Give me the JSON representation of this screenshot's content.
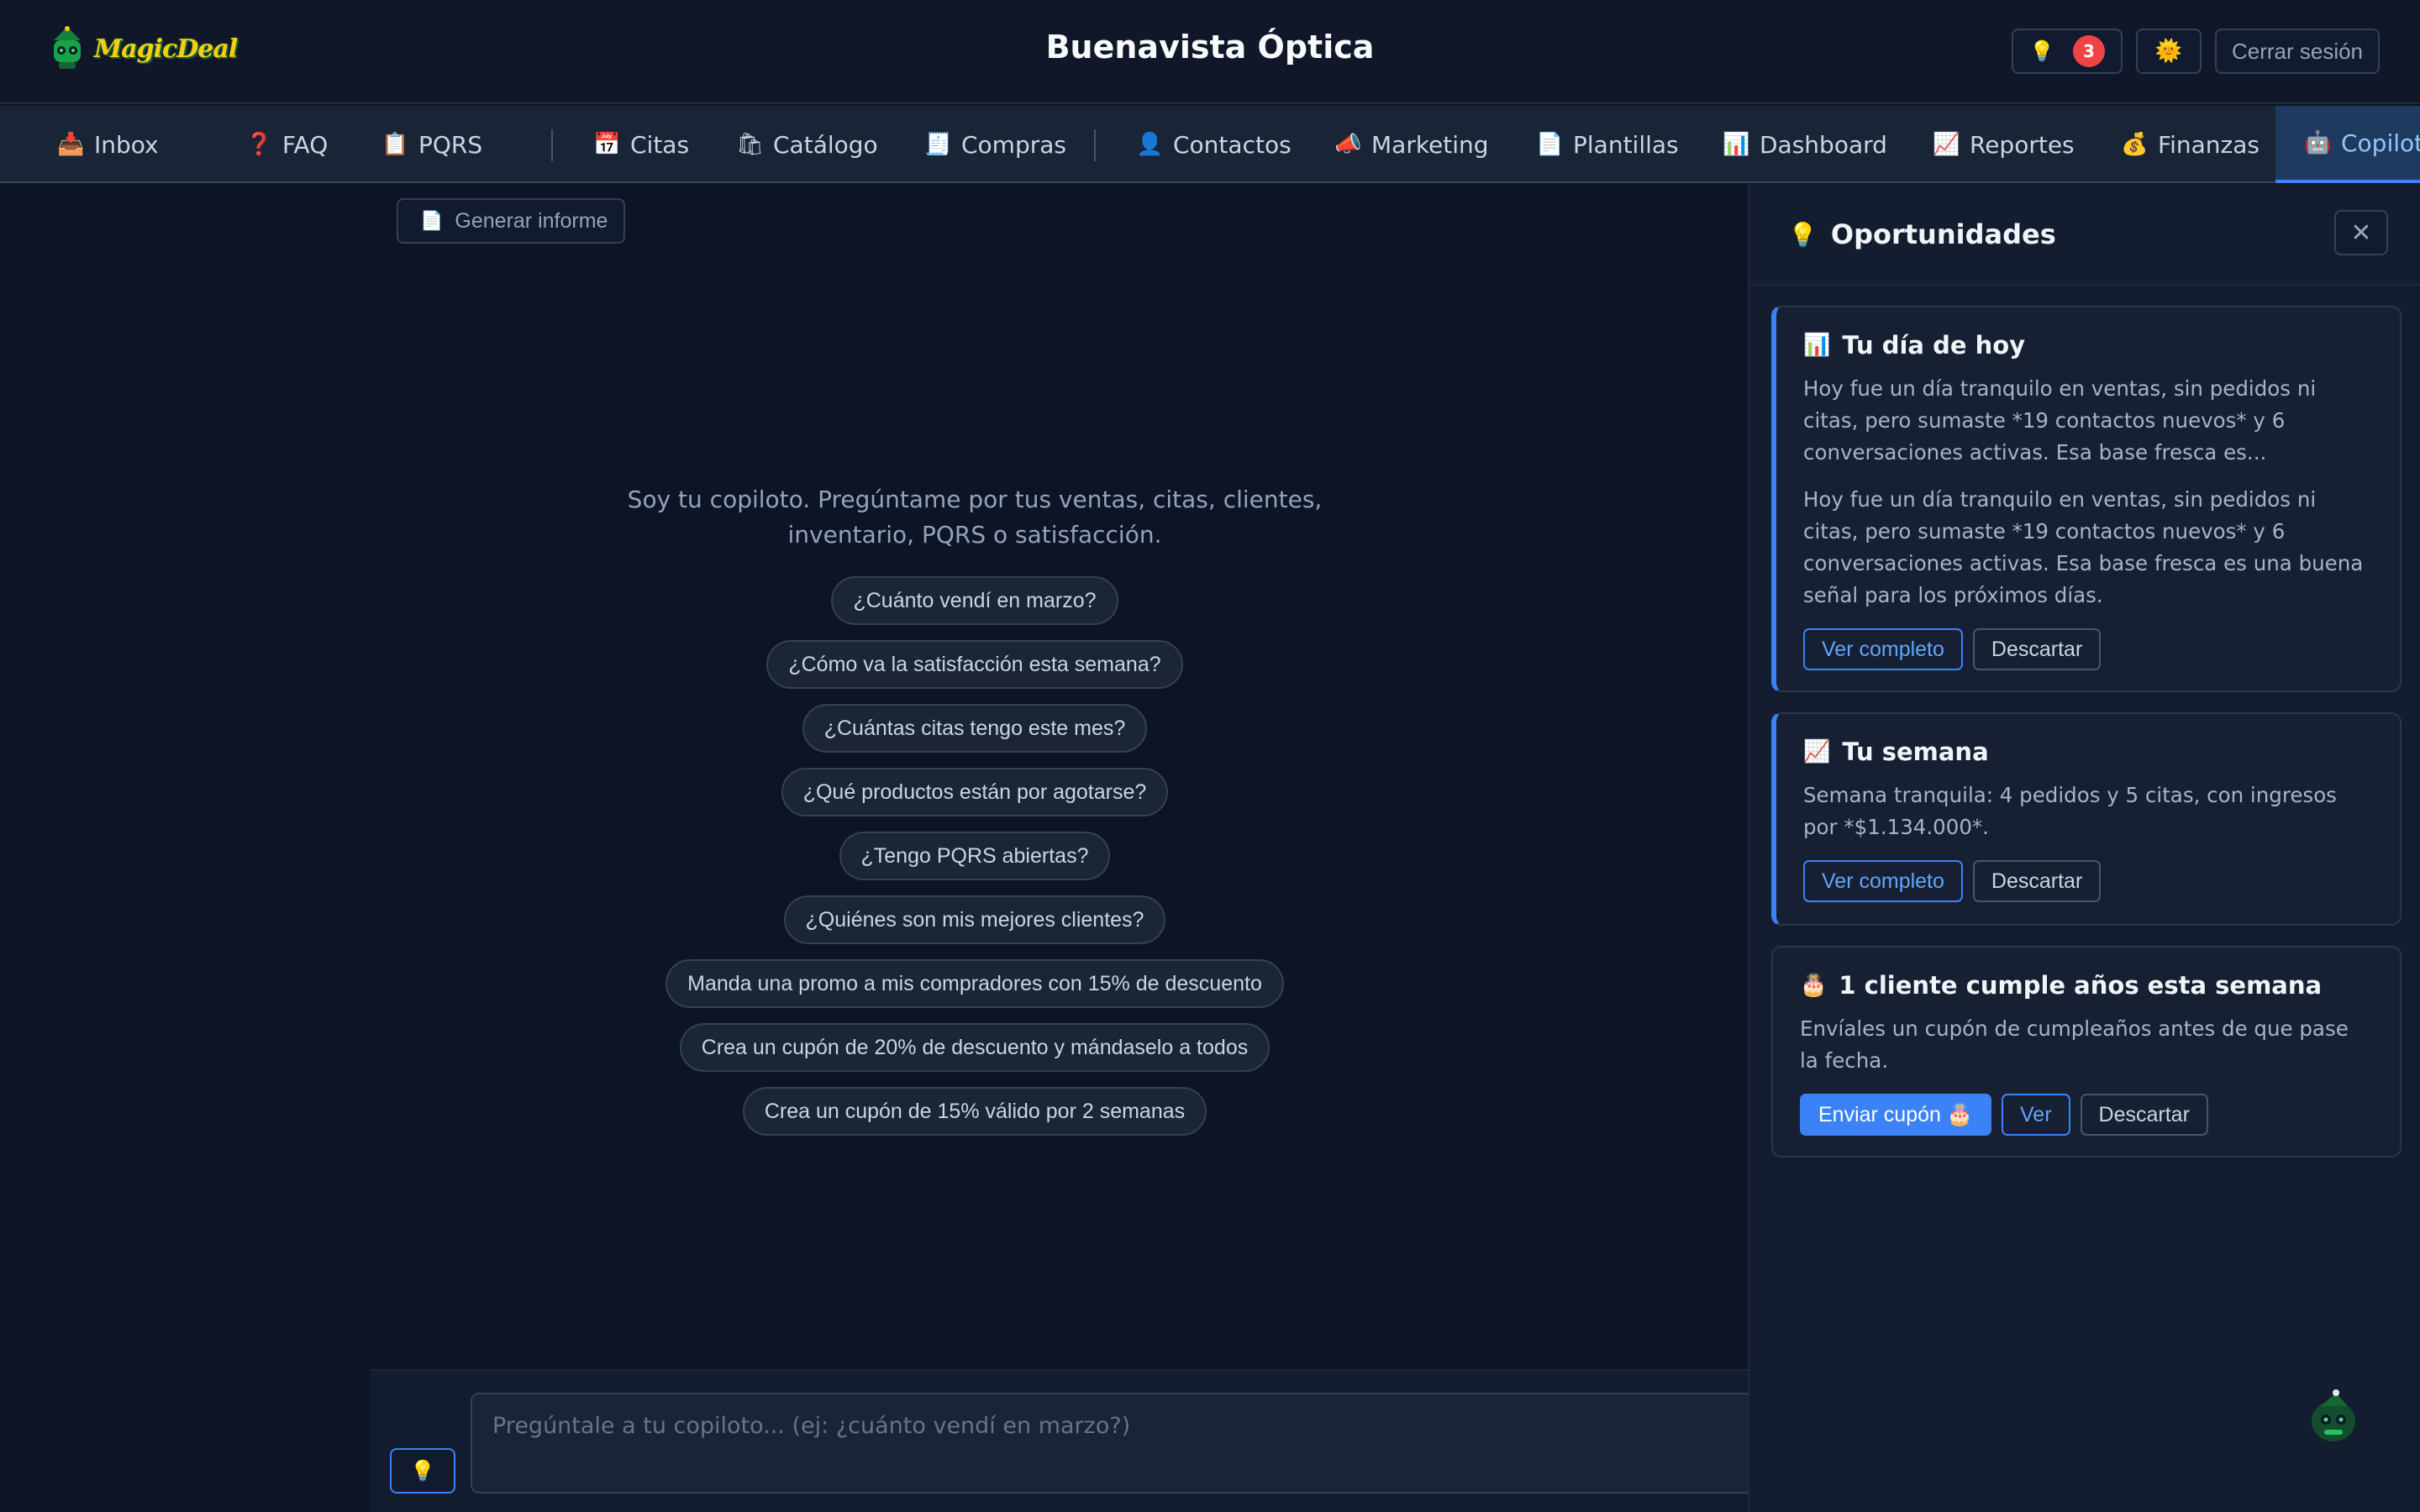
{
  "header": {
    "logo_text": "MagicDeal",
    "title": "Buenavista Óptica",
    "ideas_icon": "💡",
    "notifications_count": "3",
    "theme_icon": "🌞",
    "logout_label": "Cerrar sesión"
  },
  "nav": {
    "items": [
      {
        "icon": "📥",
        "label": "Inbox"
      },
      {
        "icon": "❓",
        "label": "FAQ"
      },
      {
        "icon": "📋",
        "label": "PQRS"
      },
      {
        "icon": "📅",
        "label": "Citas"
      },
      {
        "icon": "🛍",
        "label": "Catálogo"
      },
      {
        "icon": "🧾",
        "label": "Compras"
      },
      {
        "icon": "👤",
        "label": "Contactos"
      },
      {
        "icon": "📣",
        "label": "Marketing"
      },
      {
        "icon": "📄",
        "label": "Plantillas"
      },
      {
        "icon": "📊",
        "label": "Dashboard"
      },
      {
        "icon": "📈",
        "label": "Reportes"
      },
      {
        "icon": "💰",
        "label": "Finanzas"
      },
      {
        "icon": "🤖",
        "label": "Copilot"
      }
    ]
  },
  "main": {
    "generate_report_icon": "📄",
    "generate_report_label": "Generar informe",
    "intro_line1": "Soy tu copiloto. Pregúntame por tus ventas, citas, clientes,",
    "intro_line2": "inventario, PQRS o satisfacción.",
    "suggestions": [
      "¿Cuánto vendí en marzo?",
      "¿Cómo va la satisfacción esta semana?",
      "¿Cuántas citas tengo este mes?",
      "¿Qué productos están por agotarse?",
      "¿Tengo PQRS abiertas?",
      "¿Quiénes son mis mejores clientes?",
      "Manda una promo a mis compradores con 15% de descuento",
      "Crea un cupón de 20% de descuento y mándaselo a todos",
      "Crea un cupón de 15% válido por 2 semanas"
    ],
    "input_placeholder": "Pregúntale a tu copiloto... (ej: ¿cuánto vendí en marzo?)",
    "ideas_button_icon": "💡"
  },
  "panel": {
    "title_icon": "💡",
    "title": "Oportunidades",
    "close_icon": "✕",
    "cards": [
      {
        "icon": "📊",
        "title": "Tu día de hoy",
        "summary": "Hoy fue un día tranquilo en ventas, sin pedidos ni citas, pero sumaste *19 contactos nuevos* y 6 conversaciones activas. Esa base fresca es...",
        "full": "Hoy fue un día tranquilo en ventas, sin pedidos ni citas, pero sumaste *19 contactos nuevos* y 6 conversaciones activas. Esa base fresca es una buena señal para los próximos días.",
        "primary": "Ver completo",
        "dismiss": "Descartar"
      },
      {
        "icon": "📈",
        "title": "Tu semana",
        "summary": "Semana tranquila: 4 pedidos y 5 citas, con ingresos por *$1.134.000*.",
        "primary": "Ver completo",
        "dismiss": "Descartar"
      },
      {
        "icon": "🎂",
        "title": "1 cliente cumple años esta semana",
        "summary": "Envíales un cupón de cumpleaños antes de que pase la fecha.",
        "send": "Enviar cupón 🎂",
        "view": "Ver",
        "dismiss": "Descartar"
      }
    ]
  },
  "colors": {
    "background": "#0c1426",
    "accent": "#3b82f6",
    "badge": "#ef4444",
    "logo": "#facc15"
  }
}
